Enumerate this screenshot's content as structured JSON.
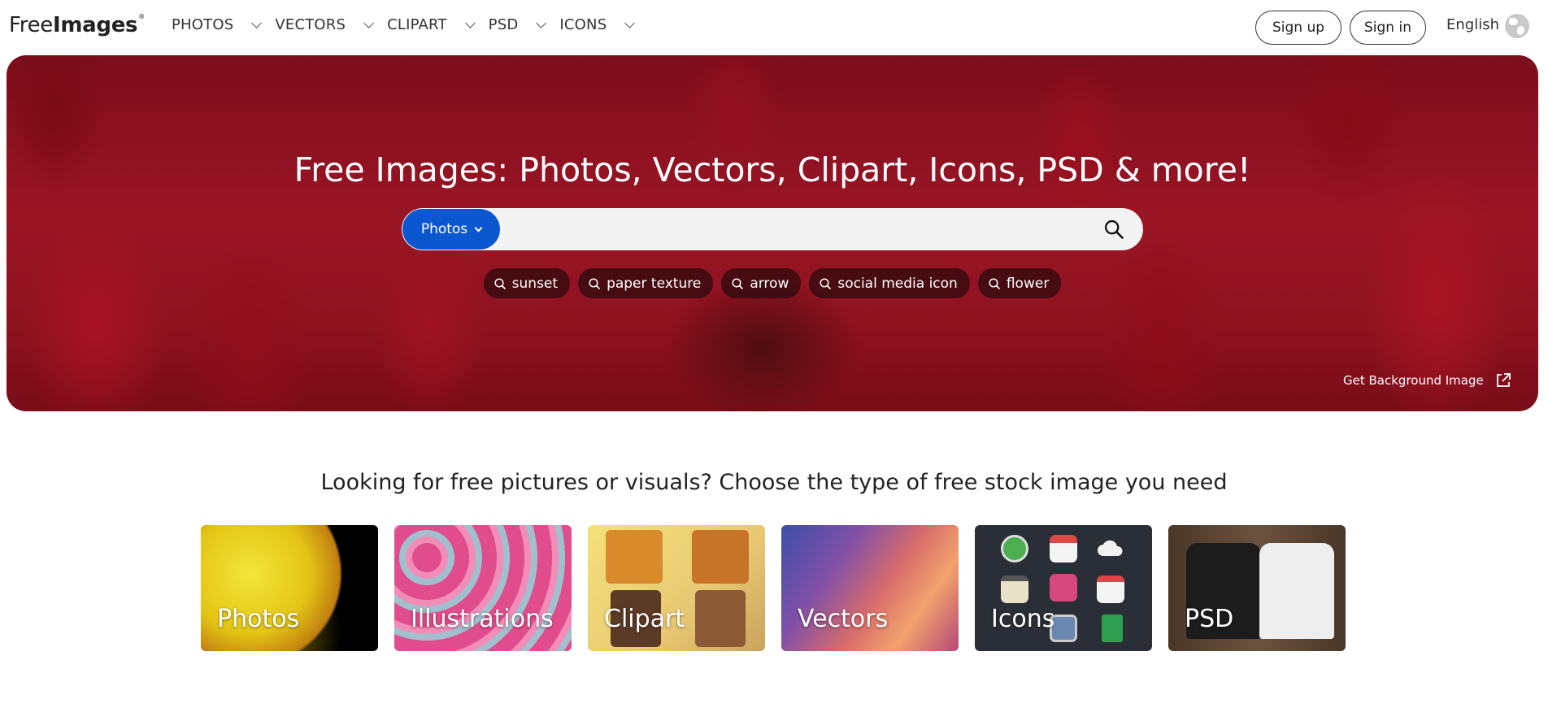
{
  "header": {
    "logo_light": "Free",
    "logo_bold": "Images",
    "logo_mark": "®",
    "nav": [
      {
        "label": "PHOTOS"
      },
      {
        "label": "VECTORS"
      },
      {
        "label": "CLIPART"
      },
      {
        "label": "PSD"
      },
      {
        "label": "ICONS"
      }
    ],
    "signup_label": "Sign up",
    "signin_label": "Sign in",
    "language": "English",
    "language_icon": "globe-icon"
  },
  "hero": {
    "title": "Free Images: Photos, Vectors, Clipart, Icons, PSD & more!",
    "search": {
      "type_label": "Photos",
      "value": "",
      "placeholder": ""
    },
    "tags": [
      {
        "label": "sunset"
      },
      {
        "label": "paper texture"
      },
      {
        "label": "arrow"
      },
      {
        "label": "social media icon"
      },
      {
        "label": "flower"
      }
    ],
    "background_link": "Get Background Image",
    "accent_color": "#0b57d0"
  },
  "categories": {
    "tagline": "Looking for free pictures or visuals? Choose the type of free stock image you need",
    "items": [
      {
        "label": "Photos"
      },
      {
        "label": "Illustrations"
      },
      {
        "label": "Clipart"
      },
      {
        "label": "Vectors"
      },
      {
        "label": "Icons"
      },
      {
        "label": "PSD"
      }
    ]
  }
}
